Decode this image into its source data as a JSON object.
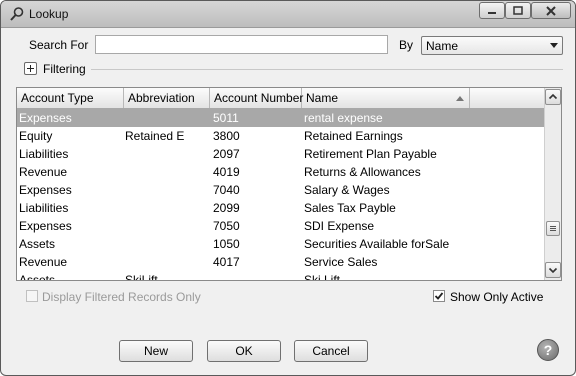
{
  "window": {
    "title": "Lookup",
    "title_icon": "magnifier-icon"
  },
  "search": {
    "label": "Search For",
    "value": "",
    "by_label": "By",
    "by_value": "Name"
  },
  "filtering": {
    "label": "Filtering",
    "toggle_icon": "plus-icon"
  },
  "grid": {
    "columns": [
      "Account Type",
      "Abbreviation",
      "Account Number",
      "Name"
    ],
    "sort_column": "Name",
    "sort_direction": "ascending",
    "selected_row": 0,
    "rows": [
      [
        "Expenses",
        "",
        "5011",
        "rental expense"
      ],
      [
        "Equity",
        "Retained E",
        "3800",
        "Retained Earnings"
      ],
      [
        "Liabilities",
        "",
        "2097",
        "Retirement Plan Payable"
      ],
      [
        "Revenue",
        "",
        "4019",
        "Returns & Allowances"
      ],
      [
        "Expenses",
        "",
        "7040",
        "Salary & Wages"
      ],
      [
        "Liabilities",
        "",
        "2099",
        "Sales Tax Payble"
      ],
      [
        "Expenses",
        "",
        "7050",
        "SDI Expense"
      ],
      [
        "Assets",
        "",
        "1050",
        "Securities Available forSale"
      ],
      [
        "Revenue",
        "",
        "4017",
        "Service Sales"
      ],
      [
        "Assets",
        "SkiLift",
        "",
        "Ski Lift"
      ]
    ]
  },
  "options": {
    "filtered_only_label": "Display Filtered Records Only",
    "filtered_only_checked": false,
    "filtered_only_enabled": false,
    "show_active_label": "Show Only Active",
    "show_active_checked": true
  },
  "buttons": {
    "new": "New",
    "ok": "OK",
    "cancel": "Cancel",
    "help": "?"
  },
  "colors": {
    "selected_row": "#a8a8a8",
    "window_bg": "#f0f0f0"
  }
}
